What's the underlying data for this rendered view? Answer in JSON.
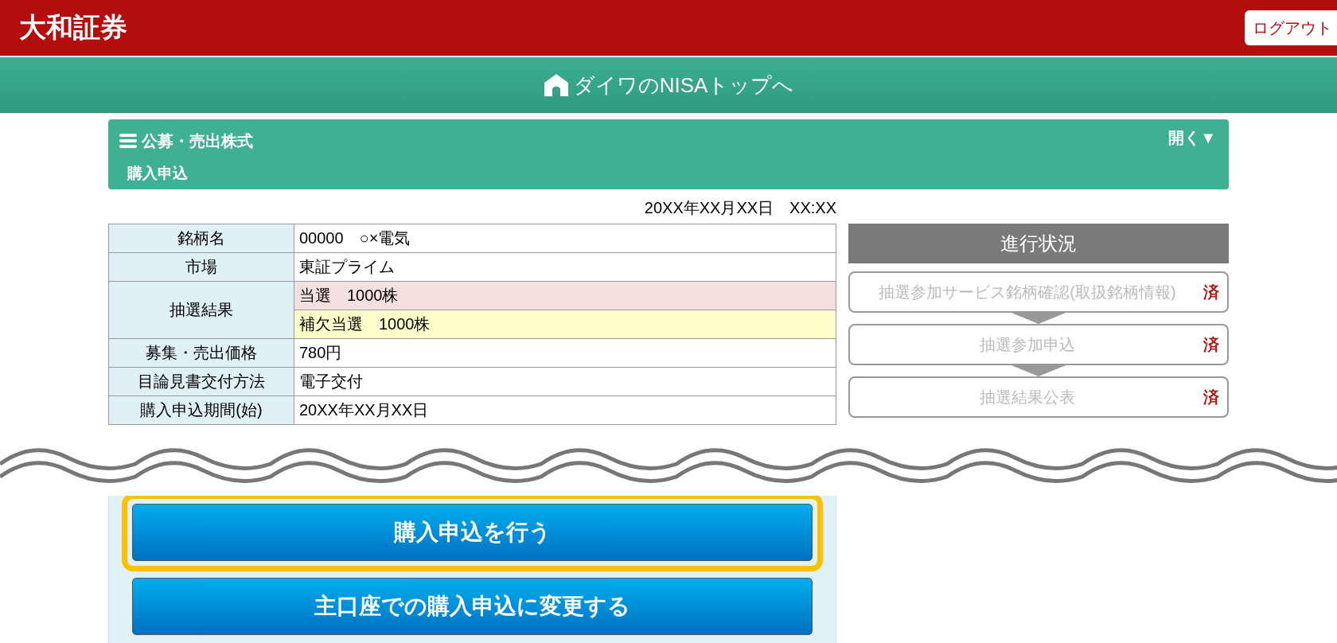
{
  "header": {
    "logo": "大和証券",
    "logout": "ログアウト"
  },
  "nav": {
    "label": "ダイワのNISAトップへ"
  },
  "section": {
    "title": "公募・売出株式",
    "subtitle": "購入申込",
    "toggle": "開く▼"
  },
  "timestamp": "20XX年XX月XX日　XX:XX",
  "table": {
    "rows": [
      {
        "label": "銘柄名",
        "values": [
          {
            "text": "00000　○×電気",
            "kind": "plain"
          }
        ]
      },
      {
        "label": "市場",
        "values": [
          {
            "text": "東証プライム",
            "kind": "plain"
          }
        ]
      },
      {
        "label": "抽選結果",
        "values": [
          {
            "text": "当選　1000株",
            "kind": "won"
          },
          {
            "text": "補欠当選　1000株",
            "kind": "waitlist"
          }
        ]
      },
      {
        "label": "募集・売出価格",
        "values": [
          {
            "text": "780円",
            "kind": "plain"
          }
        ]
      },
      {
        "label": "目論見書交付方法",
        "values": [
          {
            "text": "電子交付",
            "kind": "plain"
          }
        ]
      },
      {
        "label": "購入申込期間(始)",
        "values": [
          {
            "text": "20XX年XX月XX日",
            "kind": "plain"
          }
        ]
      }
    ]
  },
  "progress": {
    "title": "進行状況",
    "steps": [
      {
        "label": "抽選参加サービス銘柄確認(取扱銘柄情報)",
        "status": "済"
      },
      {
        "label": "抽選参加申込",
        "status": "済"
      },
      {
        "label": "抽選結果公表",
        "status": "済"
      }
    ]
  },
  "buttons": [
    {
      "label": "購入申込を行う",
      "highlighted": true
    },
    {
      "label": "主口座での購入申込に変更する",
      "highlighted": false
    }
  ]
}
